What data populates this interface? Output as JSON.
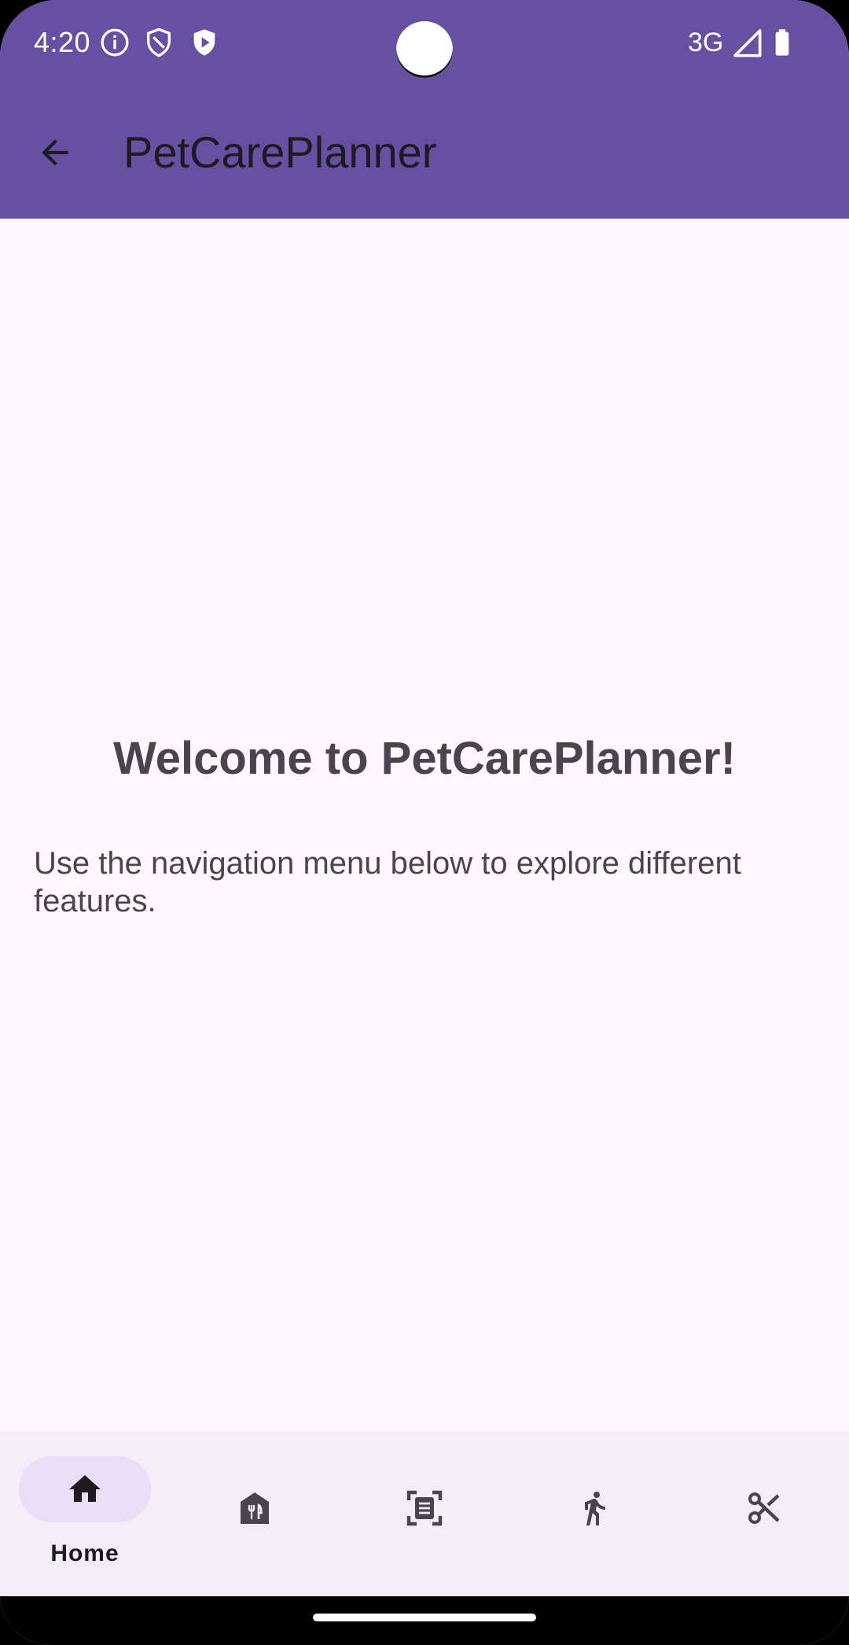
{
  "status_bar": {
    "time": "4:20",
    "network": "3G",
    "icons": [
      "info-icon",
      "shield-outline-icon",
      "shield-play-icon",
      "signal-icon",
      "battery-icon"
    ]
  },
  "app_bar": {
    "title": "PetCarePlanner",
    "back_icon": "arrow-back-icon"
  },
  "main": {
    "heading": "Welcome to PetCarePlanner!",
    "description": "Use the navigation menu below to explore different features."
  },
  "bottom_nav": {
    "items": [
      {
        "label": "Home",
        "icon": "home-icon",
        "selected": true
      },
      {
        "label": "",
        "icon": "food-store-icon",
        "selected": false
      },
      {
        "label": "",
        "icon": "document-scan-icon",
        "selected": false
      },
      {
        "label": "",
        "icon": "walking-person-icon",
        "selected": false
      },
      {
        "label": "",
        "icon": "scissors-icon",
        "selected": false
      }
    ]
  },
  "colors": {
    "primary": "#6750a4",
    "background": "#fdf7fd",
    "nav_background": "#f3edf7",
    "nav_indicator": "#e8def8",
    "text_secondary": "#49454f"
  }
}
